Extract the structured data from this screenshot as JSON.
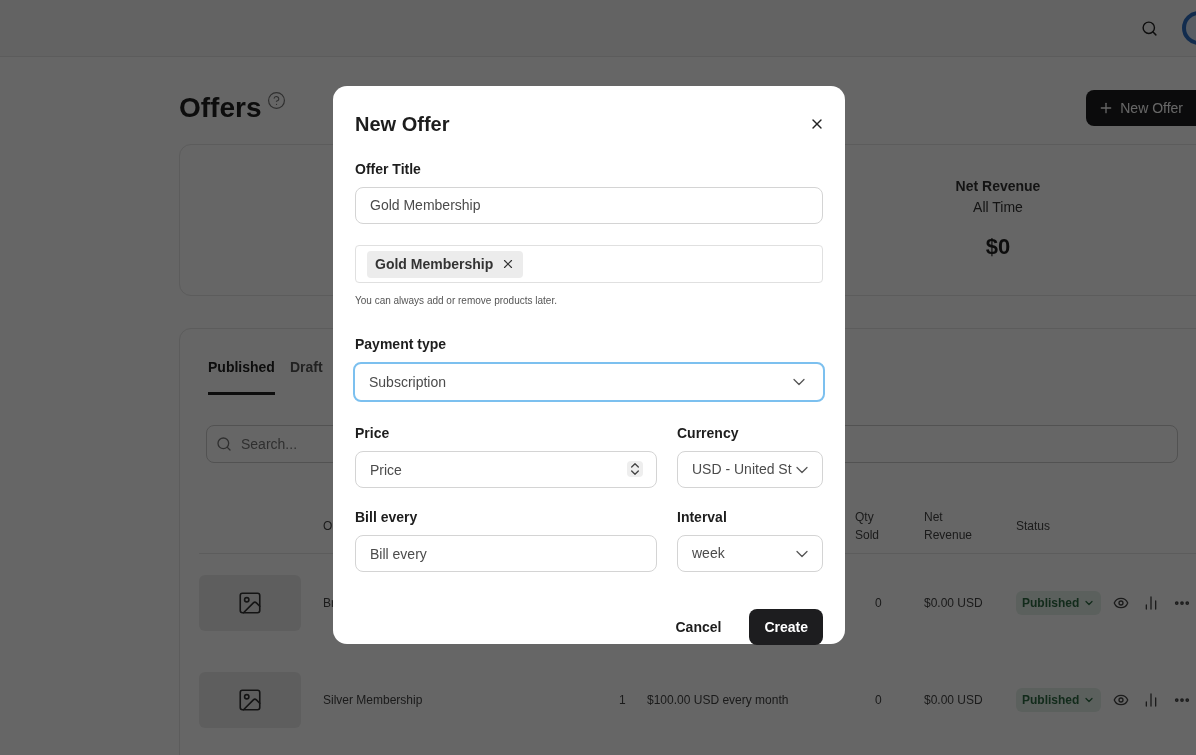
{
  "page": {
    "title": "Offers",
    "new_offer_button": "New Offer"
  },
  "stats": [
    {
      "label": "Net Revenue",
      "sublabel": "All Time",
      "value": "$0"
    }
  ],
  "tabs": [
    {
      "label": "Published",
      "selected": true
    },
    {
      "label": "Draft",
      "selected": false
    }
  ],
  "search": {
    "placeholder": "Search..."
  },
  "table": {
    "columns": [
      {
        "label": "O"
      },
      {
        "label": "Qty Sold"
      },
      {
        "label": "Net Revenue"
      },
      {
        "label": "Status"
      }
    ],
    "rows": [
      {
        "name": "Br",
        "qty_sold": "0",
        "net_revenue": "$0.00 USD",
        "status": "Published"
      },
      {
        "name": "Silver Membership",
        "count": "1",
        "price": "$100.00 USD every month",
        "qty_sold": "0",
        "net_revenue": "$0.00 USD",
        "status": "Published"
      }
    ]
  },
  "modal": {
    "title": "New Offer",
    "offer_title": {
      "label": "Offer Title",
      "value": "Gold Membership"
    },
    "products": {
      "tags": [
        {
          "label": "Gold Membership"
        }
      ],
      "hint": "You can always add or remove products later."
    },
    "payment_type": {
      "label": "Payment type",
      "value": "Subscription",
      "focused": true
    },
    "price": {
      "label": "Price",
      "placeholder": "Price"
    },
    "currency": {
      "label": "Currency",
      "value": "USD - United St"
    },
    "bill_every": {
      "label": "Bill every",
      "placeholder": "Bill every"
    },
    "interval": {
      "label": "Interval",
      "value": "week"
    },
    "buttons": [
      {
        "kind": "secondary",
        "label": "Cancel"
      },
      {
        "kind": "primary",
        "label": "Create"
      }
    ]
  }
}
